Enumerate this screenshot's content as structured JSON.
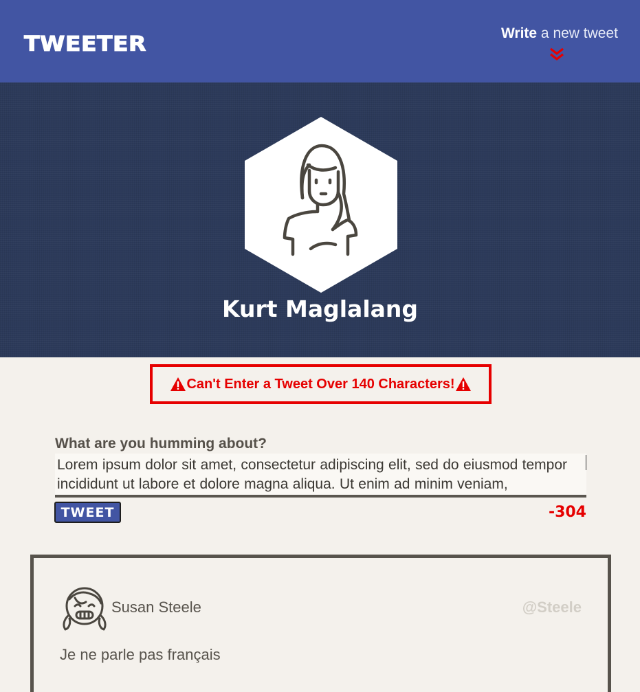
{
  "header": {
    "brand": "TWEETER",
    "write_bold": "Write",
    "write_rest": " a new tweet",
    "accent": "#e60000",
    "bg": "#4255a3"
  },
  "profile": {
    "name": "Kurt Maglalang",
    "avatar_icon": "woman-avatar-icon"
  },
  "alert": {
    "message": "Can't Enter a Tweet Over 140 Characters!"
  },
  "compose": {
    "label": "What are you humming about?",
    "value": "Lorem ipsum dolor sit amet, consectetur adipiscing elit, sed do eiusmod tempor incididunt ut labore et dolore magna aliqua. Ut enim ad minim veniam,",
    "button_label": "TWEET",
    "counter": "-304"
  },
  "tweets": [
    {
      "author": "Susan Steele",
      "handle": "@Steele",
      "text": "Je ne parle pas français",
      "avatar_icon": "girl-avatar-icon"
    }
  ]
}
